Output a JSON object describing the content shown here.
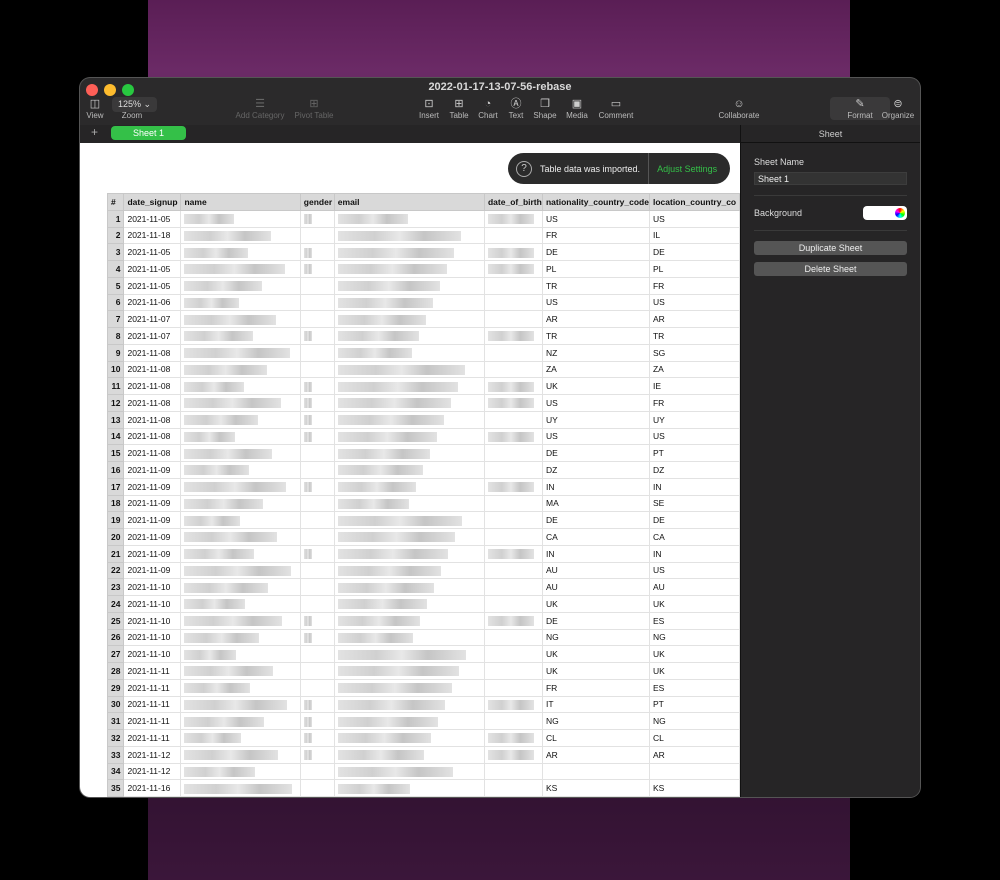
{
  "window": {
    "title": "2022-01-17-13-07-56-rebase"
  },
  "toolbar": {
    "zoom_value": "125%",
    "items": [
      {
        "id": "view",
        "label": "View",
        "icon": "sidebar-icon",
        "glyph": "◫"
      },
      {
        "id": "zoom",
        "label": "Zoom"
      },
      {
        "id": "add-category",
        "label": "Add Category",
        "icon": "list-icon",
        "glyph": "☰",
        "disabled": true
      },
      {
        "id": "pivot-table",
        "label": "Pivot Table",
        "icon": "pivot-icon",
        "glyph": "⊞",
        "disabled": true
      },
      {
        "id": "insert",
        "label": "Insert",
        "icon": "insert-icon",
        "glyph": "⊡"
      },
      {
        "id": "table",
        "label": "Table",
        "icon": "table-icon",
        "glyph": "⊞"
      },
      {
        "id": "chart",
        "label": "Chart",
        "icon": "chart-icon",
        "glyph": "◔"
      },
      {
        "id": "text",
        "label": "Text",
        "icon": "text-icon",
        "glyph": "Ⓐ"
      },
      {
        "id": "shape",
        "label": "Shape",
        "icon": "shape-icon",
        "glyph": "❒"
      },
      {
        "id": "media",
        "label": "Media",
        "icon": "media-icon",
        "glyph": "▣"
      },
      {
        "id": "comment",
        "label": "Comment",
        "icon": "comment-icon",
        "glyph": "▭"
      },
      {
        "id": "collaborate",
        "label": "Collaborate",
        "icon": "collaborate-icon",
        "glyph": "☺"
      },
      {
        "id": "format",
        "label": "Format",
        "icon": "paintbrush-icon",
        "glyph": "✎"
      },
      {
        "id": "organize",
        "label": "Organize",
        "icon": "organize-icon",
        "glyph": "⊜"
      }
    ]
  },
  "tabs": {
    "add": "+",
    "sheet": "Sheet 1"
  },
  "toast": {
    "icon": "?",
    "message": "Table data was imported.",
    "action": "Adjust Settings"
  },
  "table": {
    "headers": [
      "#",
      "date_signup",
      "name",
      "gender",
      "email",
      "date_of_birth",
      "nationality_country_code",
      "location_country_co"
    ],
    "rows": [
      [
        "1",
        "2021-11-05",
        "US",
        "US",
        1,
        1
      ],
      [
        "2",
        "2021-11-18",
        "FR",
        "IL",
        0,
        0
      ],
      [
        "3",
        "2021-11-05",
        "DE",
        "DE",
        1,
        1
      ],
      [
        "4",
        "2021-11-05",
        "PL",
        "PL",
        1,
        1
      ],
      [
        "5",
        "2021-11-05",
        "TR",
        "FR",
        0,
        0
      ],
      [
        "6",
        "2021-11-06",
        "US",
        "US",
        0,
        0
      ],
      [
        "7",
        "2021-11-07",
        "AR",
        "AR",
        0,
        0
      ],
      [
        "8",
        "2021-11-07",
        "TR",
        "TR",
        1,
        1
      ],
      [
        "9",
        "2021-11-08",
        "NZ",
        "SG",
        0,
        0
      ],
      [
        "10",
        "2021-11-08",
        "ZA",
        "ZA",
        0,
        0
      ],
      [
        "11",
        "2021-11-08",
        "UK",
        "IE",
        1,
        1
      ],
      [
        "12",
        "2021-11-08",
        "US",
        "FR",
        1,
        1
      ],
      [
        "13",
        "2021-11-08",
        "UY",
        "UY",
        1,
        0
      ],
      [
        "14",
        "2021-11-08",
        "US",
        "US",
        1,
        1
      ],
      [
        "15",
        "2021-11-08",
        "DE",
        "PT",
        0,
        0
      ],
      [
        "16",
        "2021-11-09",
        "DZ",
        "DZ",
        0,
        0
      ],
      [
        "17",
        "2021-11-09",
        "IN",
        "IN",
        1,
        1
      ],
      [
        "18",
        "2021-11-09",
        "MA",
        "SE",
        0,
        0
      ],
      [
        "19",
        "2021-11-09",
        "DE",
        "DE",
        0,
        0
      ],
      [
        "20",
        "2021-11-09",
        "CA",
        "CA",
        0,
        0
      ],
      [
        "21",
        "2021-11-09",
        "IN",
        "IN",
        1,
        1
      ],
      [
        "22",
        "2021-11-09",
        "AU",
        "US",
        0,
        0
      ],
      [
        "23",
        "2021-11-10",
        "AU",
        "AU",
        0,
        0
      ],
      [
        "24",
        "2021-11-10",
        "UK",
        "UK",
        0,
        0
      ],
      [
        "25",
        "2021-11-10",
        "DE",
        "ES",
        1,
        1
      ],
      [
        "26",
        "2021-11-10",
        "NG",
        "NG",
        1,
        0
      ],
      [
        "27",
        "2021-11-10",
        "UK",
        "UK",
        0,
        0
      ],
      [
        "28",
        "2021-11-11",
        "UK",
        "UK",
        0,
        0
      ],
      [
        "29",
        "2021-11-11",
        "FR",
        "ES",
        0,
        0
      ],
      [
        "30",
        "2021-11-11",
        "IT",
        "PT",
        1,
        1
      ],
      [
        "31",
        "2021-11-11",
        "NG",
        "NG",
        1,
        0
      ],
      [
        "32",
        "2021-11-11",
        "CL",
        "CL",
        1,
        1
      ],
      [
        "33",
        "2021-11-12",
        "AR",
        "AR",
        1,
        1
      ],
      [
        "34",
        "2021-11-12",
        "",
        "",
        0,
        0
      ],
      [
        "35",
        "2021-11-16",
        "KS",
        "KS",
        0,
        0
      ]
    ]
  },
  "sidebar": {
    "header": "Sheet",
    "sheet_name_label": "Sheet Name",
    "sheet_name_value": "Sheet 1",
    "background_label": "Background",
    "background_color": "#ffffff",
    "duplicate": "Duplicate Sheet",
    "delete": "Delete Sheet"
  }
}
